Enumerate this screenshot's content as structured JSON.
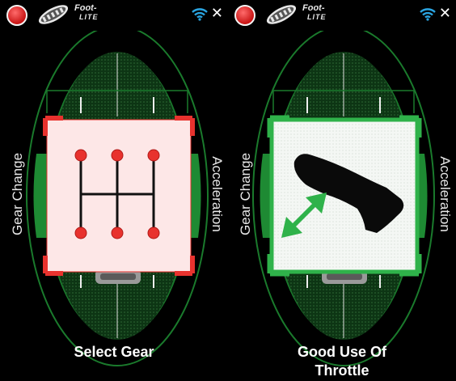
{
  "screens": [
    {
      "brand_line1": "Foot-",
      "brand_line2": "LITE",
      "left_label": "Gear Change",
      "right_label": "Acceleration",
      "caption_line1": "Select Gear",
      "caption_line2": "",
      "card_theme": "red",
      "card_icon": "gear-shift-icon",
      "colors": {
        "card_bg": "#fde7e7",
        "card_accent": "#e8322e"
      }
    },
    {
      "brand_line1": "Foot-",
      "brand_line2": "LITE",
      "left_label": "Gear Change",
      "right_label": "Acceleration",
      "caption_line1": "Good Use Of",
      "caption_line2": "Throttle",
      "card_theme": "green",
      "card_icon": "throttle-foot-icon",
      "colors": {
        "card_bg": "#ffffff",
        "card_accent": "#2fb24a"
      }
    }
  ],
  "colors": {
    "ring_green": "#1a7a2c",
    "track_green": "#0f3d17"
  }
}
